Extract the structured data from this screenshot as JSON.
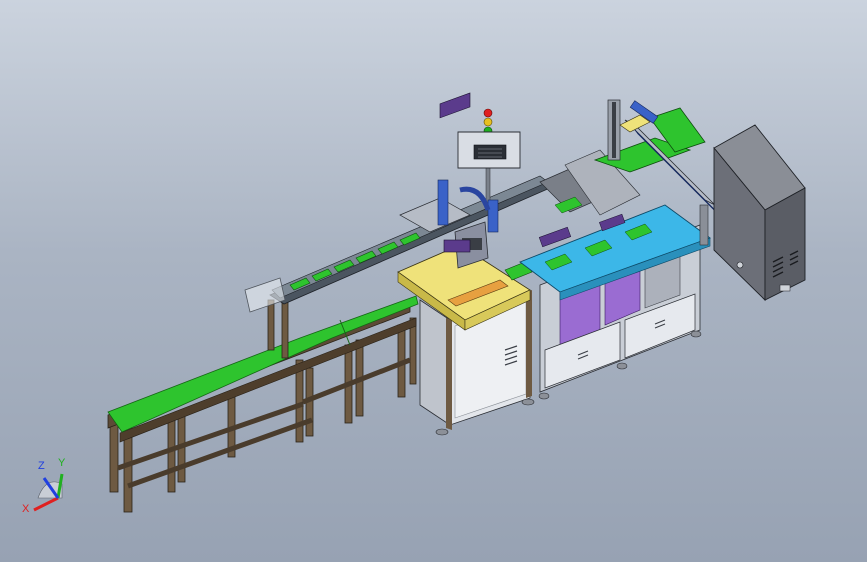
{
  "axes": {
    "x_label": "X",
    "y_label": "Y",
    "z_label": "Z",
    "x_color": "#e02020",
    "y_color": "#20b020",
    "z_color": "#2040e0"
  },
  "colors": {
    "background_top": "#cbd3de",
    "background_bottom": "#97a2b3",
    "conveyor_belt": "#2ec42e",
    "frame_brown": "#6e5a42",
    "cabinet_grey": "#6c6f78",
    "panel_yellow": "#efe27a",
    "panel_blue": "#3cb7e8",
    "accent_purple": "#8a4bd0",
    "light_panel": "#d9dde4"
  },
  "parts": [
    "infeed-conveyor",
    "pcb-conveyor",
    "inspection-station",
    "tower-light",
    "hmi-panel",
    "assembly-station",
    "gantry-robot",
    "control-cabinet"
  ]
}
